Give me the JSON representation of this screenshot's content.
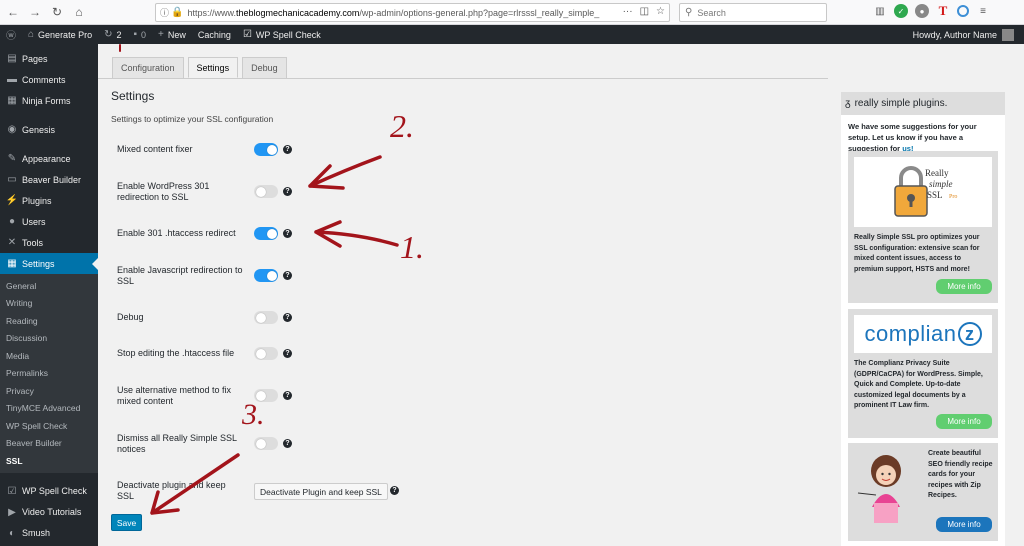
{
  "browser": {
    "url_prefix": "https://www.",
    "url_host": "theblogmechanicacademy.com",
    "url_path": "/wp-admin/options-general.php?page=rlrsssl_really_simple_",
    "search_placeholder": "Search"
  },
  "adminbar": {
    "site_name": "Generate Pro",
    "updates_count": "2",
    "comments_count": "0",
    "new_label": "New",
    "caching_label": "Caching",
    "spellcheck_label": "WP Spell Check",
    "howdy": "Howdy, Author Name"
  },
  "sidebar": {
    "items_top": [
      {
        "label": "Pages",
        "icon": "pages-icon"
      },
      {
        "label": "Comments",
        "icon": "comments-icon"
      },
      {
        "label": "Ninja Forms",
        "icon": "ninja-forms-icon"
      }
    ],
    "genesis": "Genesis",
    "items_mid": [
      {
        "label": "Appearance",
        "icon": "appearance-icon"
      },
      {
        "label": "Beaver Builder",
        "icon": "beaver-builder-icon"
      },
      {
        "label": "Plugins",
        "icon": "plugins-icon"
      },
      {
        "label": "Users",
        "icon": "users-icon"
      },
      {
        "label": "Tools",
        "icon": "tools-icon"
      }
    ],
    "settings": "Settings",
    "submenu": [
      "General",
      "Writing",
      "Reading",
      "Discussion",
      "Media",
      "Permalinks",
      "Privacy",
      "TinyMCE Advanced",
      "WP Spell Check",
      "Beaver Builder",
      "SSL"
    ],
    "items_bottom": [
      {
        "label": "WP Spell Check",
        "icon": "spell-check-icon"
      },
      {
        "label": "Video Tutorials",
        "icon": "video-icon"
      },
      {
        "label": "Smush",
        "icon": "smush-icon"
      }
    ]
  },
  "tabs": [
    "Configuration",
    "Settings",
    "Debug"
  ],
  "heading": "Settings",
  "description": "Settings to optimize your SSL configuration",
  "settings_rows": [
    {
      "label": "Mixed content fixer",
      "on": true
    },
    {
      "label": "Enable WordPress 301 redirection to SSL",
      "on": false
    },
    {
      "label": "Enable 301 .htaccess redirect",
      "on": true
    },
    {
      "label": "Enable Javascript redirection to SSL",
      "on": true
    },
    {
      "label": "Debug",
      "on": false
    },
    {
      "label": "Stop editing the .htaccess file",
      "on": false
    },
    {
      "label": "Use alternative method to fix mixed content",
      "on": false
    },
    {
      "label": "Dismiss all Really Simple SSL notices",
      "on": false
    }
  ],
  "deactivate": {
    "label": "Deactivate plugin and keep SSL",
    "button": "Deactivate Plugin and keep SSL"
  },
  "save": "Save",
  "help_glyph": "?",
  "rsp": {
    "header": "really simple plugins.",
    "intro": "We have some suggestions for your setup. Let us know if you have a suggestion for",
    "intro_link": "us!",
    "cards": [
      {
        "logo_text": "Really Simple SSL Pro",
        "logo_line1": "Really",
        "logo_line2": "simple",
        "logo_line3": "SSL",
        "logo_pro": "Pro",
        "text": "Really Simple SSL pro optimizes your SSL configuration: extensive scan for mixed content issues, access to premium support, HSTS and more!",
        "button": "More info"
      },
      {
        "logo_text": "complianz",
        "logo_main": "complian",
        "logo_z": "z",
        "text": "The Complianz Privacy Suite (GDPR/CaCPA) for WordPress. Simple, Quick and Complete. Up-to-date customized legal documents by a prominent IT Law firm.",
        "button": "More info"
      },
      {
        "text": "Create beautiful SEO friendly recipe cards for your recipes with Zip Recipes.",
        "button": "More info"
      }
    ]
  },
  "annotations": [
    "2.",
    "1.",
    "3."
  ],
  "colors": {
    "admin_bar": "#23282d",
    "active_menu": "#0073aa",
    "toggle_on": "#2196f3",
    "annotation": "#a3141b",
    "green_button": "#61ce70",
    "blue_button": "#1c75bc"
  }
}
